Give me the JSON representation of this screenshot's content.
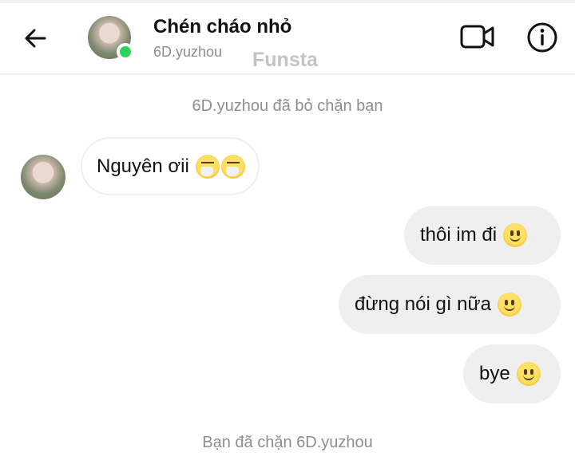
{
  "header": {
    "contact_name": "Chén cháo nhỏ",
    "username": "6D.yuzhou",
    "watermark": "Funsta",
    "icons": {
      "back": "arrow-left-icon",
      "video": "video-camera-icon",
      "info": "info-icon"
    },
    "online_color": "#2bd45a"
  },
  "system": {
    "unblocked": "6D.yuzhou đã bỏ chặn bạn",
    "blocked": "Bạn đã chặn 6D.yuzhou"
  },
  "messages": [
    {
      "direction": "incoming",
      "text": "Nguyên ơii",
      "emoji": [
        "sneezing-face-emoji",
        "sneezing-face-emoji"
      ]
    },
    {
      "direction": "outgoing",
      "text": "thôi im đi",
      "emoji": [
        "slightly-smiling-face-emoji"
      ]
    },
    {
      "direction": "outgoing",
      "text": "đừng nói gì nữa",
      "emoji": [
        "slightly-smiling-face-emoji"
      ]
    },
    {
      "direction": "outgoing",
      "text": "bye",
      "emoji": [
        "slightly-smiling-face-emoji"
      ]
    }
  ],
  "colors": {
    "bubble_outgoing": "#efefef",
    "bubble_incoming_border": "#efefef",
    "muted_text": "#8e8e8e"
  }
}
